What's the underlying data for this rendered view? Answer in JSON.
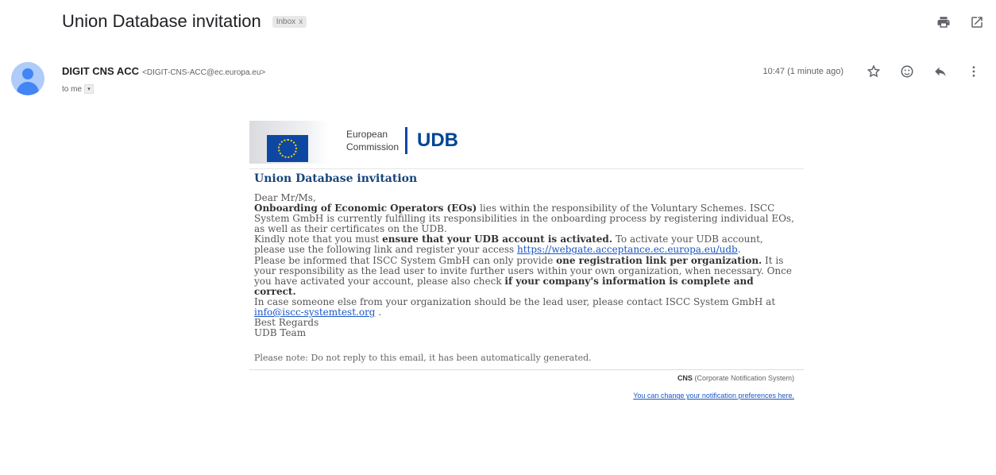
{
  "subject": "Union Database invitation",
  "label": {
    "name": "Inbox",
    "remove": "x"
  },
  "sender": {
    "name": "DIGIT CNS ACC",
    "email": "<DIGIT-CNS-ACC@ec.europa.eu>",
    "to": "to me",
    "dropdown": "▾",
    "timestamp": "10:47 (1 minute ago)"
  },
  "icons": {
    "print": "print-icon",
    "open_new": "open-in-new-icon",
    "star": "star-icon",
    "emoji": "emoji-icon",
    "reply": "reply-icon",
    "more": "more-vert-icon"
  },
  "banner": {
    "org_line1": "European",
    "org_line2": "Commission",
    "product": "UDB",
    "brand_color": "#004494"
  },
  "body": {
    "title": "Union Database invitation",
    "greeting": "Dear Mr/Ms,",
    "p1_bold": "Onboarding of Economic Operators (EOs)",
    "p1_rest": " lies within the responsibility of the Voluntary Schemes. ISCC System GmbH is currently fulfilling its responsibilities in the onboarding process by registering individual EOs, as well as their certificates on the UDB.",
    "p2_pre": "Kindly note that you must ",
    "p2_bold": "ensure that your UDB account is activated.",
    "p2_post": " To activate your UDB account, please use the following link and register your access ",
    "p2_link": "https://webgate.acceptance.ec.europa.eu/udb",
    "p2_end": ".",
    "p3_pre": "Please be informed that ISCC System GmbH can only provide ",
    "p3_bold": "one registration link per organization.",
    "p3_mid": " It is your responsibility as the lead user to invite further users within your own organization, when necessary. Once you have activated your account, please also check ",
    "p3_bold2": "if your company's information is complete and correct.",
    "p4_pre": "In case someone else from your organization should be the lead user, please contact ISCC System GmbH at ",
    "p4_link": "info@iscc-systemtest.org",
    "p4_end": " .",
    "closing1": "Best Regards",
    "closing2": "UDB Team",
    "note": "Please note: Do not reply to this email, it has been automatically generated."
  },
  "footer": {
    "cns_bold": "CNS",
    "cns_rest": " (Corporate Notification System)",
    "preferences_link": "You can change your notification preferences here."
  }
}
